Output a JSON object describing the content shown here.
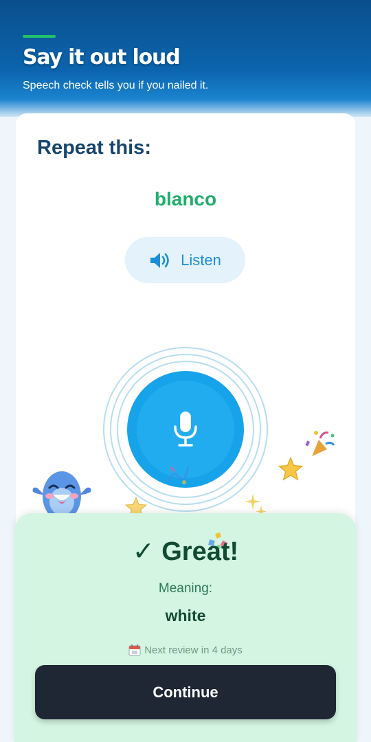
{
  "header": {
    "title": "Say it out loud",
    "subtitle": "Speech check tells you if you nailed it."
  },
  "prompt": {
    "label": "Repeat this:",
    "word": "blanco"
  },
  "listen_button": {
    "label": "Listen",
    "icon": "speaker-icon"
  },
  "mic": {
    "icon": "microphone-icon"
  },
  "feedback": {
    "result": "✓ Great!",
    "meaning_label": "Meaning:",
    "meaning_value": "white",
    "review_icon": "calendar-icon",
    "review_text": "Next review in 4 days",
    "continue_label": "Continue"
  },
  "colors": {
    "header": "#0b64ad",
    "accent_green": "#1fae6c",
    "mic_blue": "#17a3ea",
    "sheet_bg": "#d3f5e1",
    "button_dark": "#1f2634"
  }
}
